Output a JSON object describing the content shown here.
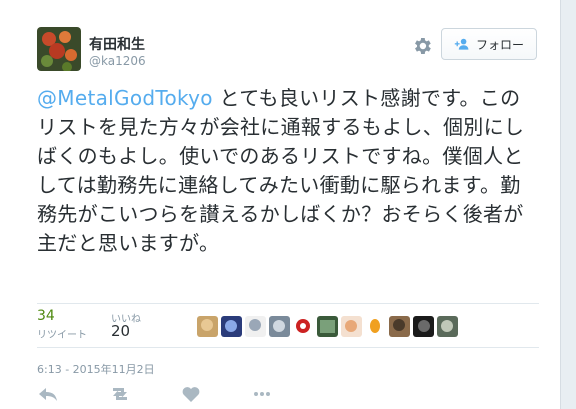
{
  "user": {
    "display_name": "有田和生",
    "handle": "@ka1206"
  },
  "header": {
    "follow_label": "フォロー",
    "settings_icon": "gear-icon",
    "follow_icon": "add-user-icon"
  },
  "tweet": {
    "mention": "@MetalGodTokyo",
    "body": " とても良いリスト感謝です。このリストを見た方々が会社に通報するもよし、個別にしばくのもよし。使いでのあるリストですね。僕個人としては勤務先に連絡してみたい衝動に駆られます。勤務先がこいつらを讃えるかしばくか？おそらく後者が主だと思いますが。"
  },
  "stats": {
    "retweets_count": "34",
    "retweets_label": "リツイート",
    "likes_count": "20",
    "likes_label": "いいね"
  },
  "timestamp": "6:13 - 2015年11月2日",
  "actions": [
    "reply-icon",
    "retweet-icon",
    "like-icon",
    "more-icon"
  ],
  "colors": {
    "link": "#55acee",
    "text": "#292f33",
    "muted": "#8899a6",
    "retweet_count": "#4f8a10"
  }
}
